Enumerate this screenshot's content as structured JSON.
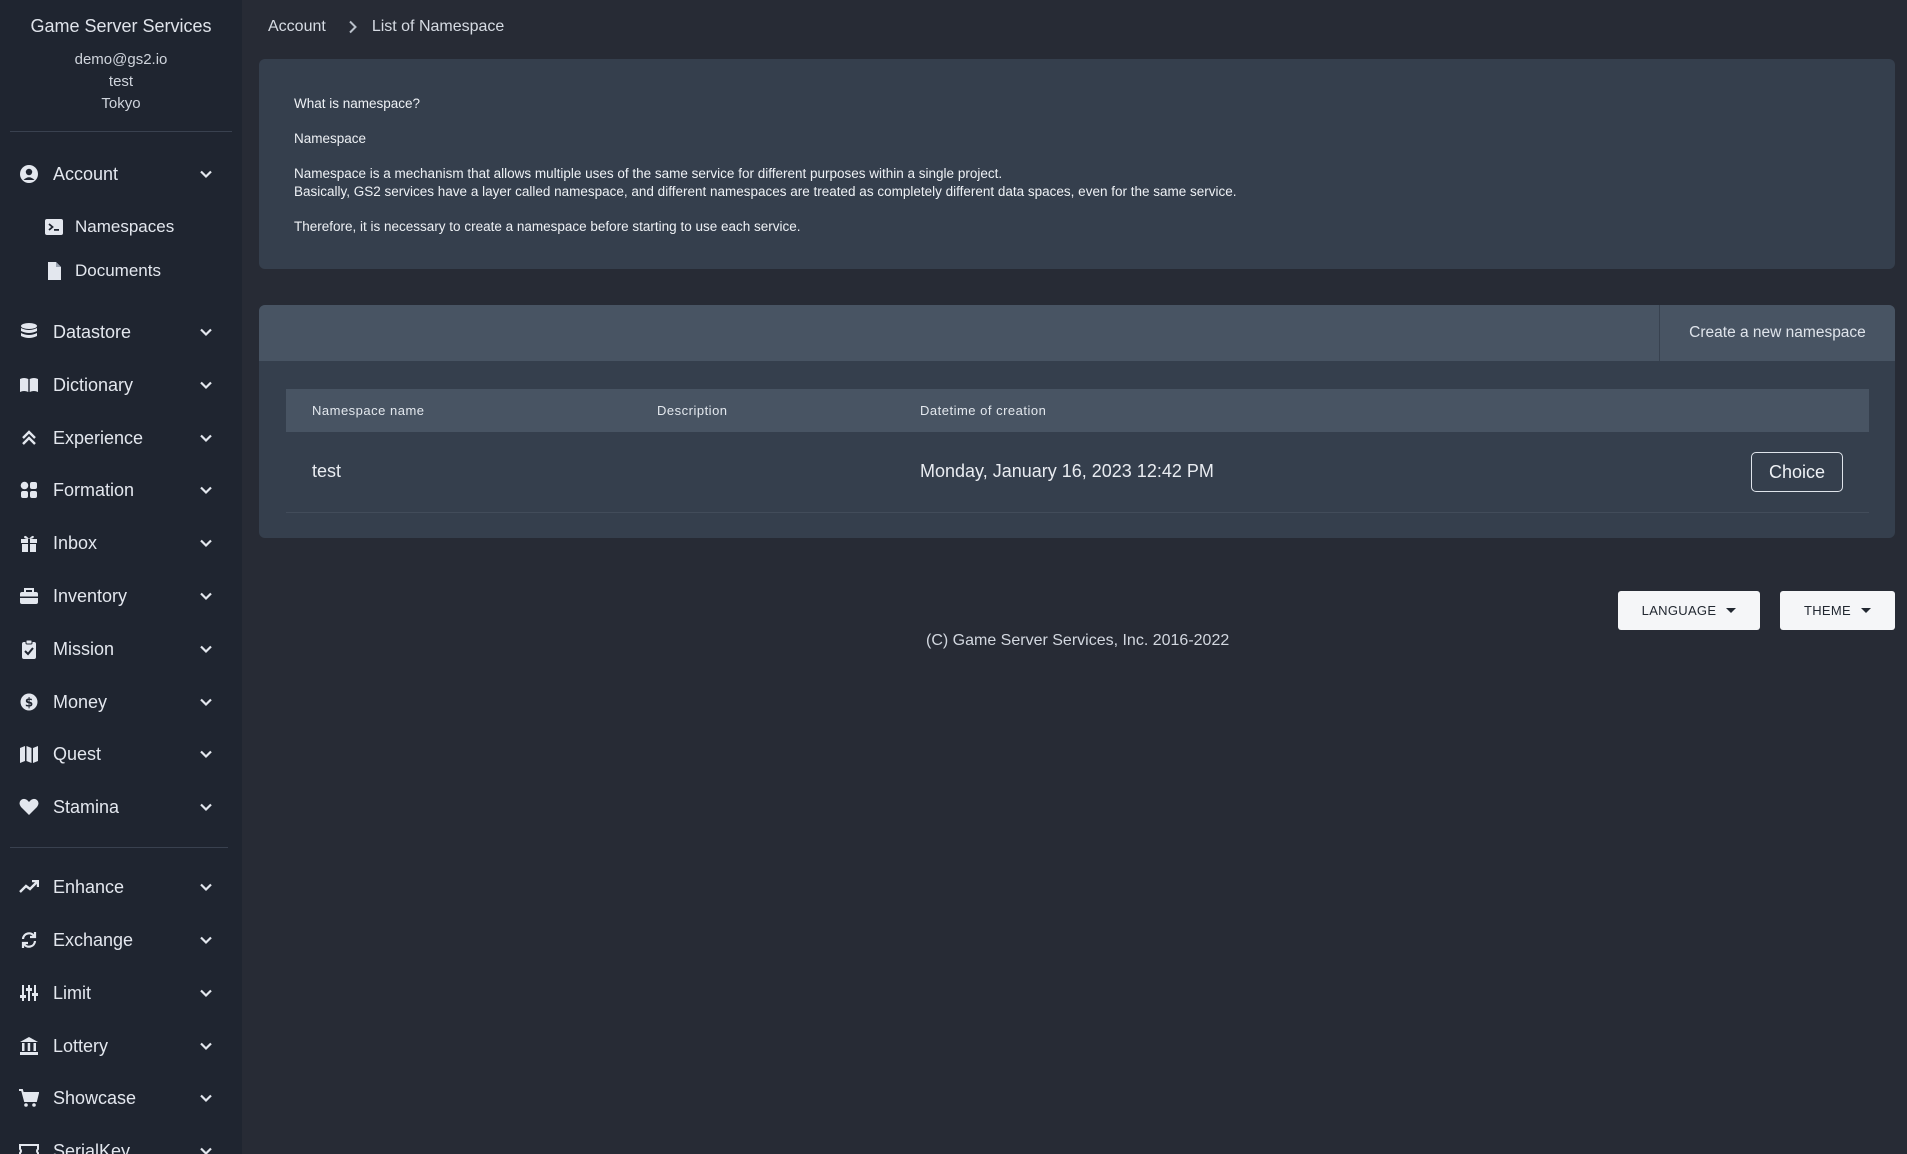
{
  "sidebar": {
    "title": "Game Server Services",
    "user_email": "demo@gs2.io",
    "project": "test",
    "region": "Tokyo",
    "sections": [
      {
        "label": "Account",
        "icon": "user-circle-icon"
      },
      {
        "label": "Datastore",
        "icon": "database-icon"
      },
      {
        "label": "Dictionary",
        "icon": "book-icon"
      },
      {
        "label": "Experience",
        "icon": "double-chevron-up-icon"
      },
      {
        "label": "Formation",
        "icon": "grid-icon"
      },
      {
        "label": "Inbox",
        "icon": "gift-icon"
      },
      {
        "label": "Inventory",
        "icon": "toolbox-icon"
      },
      {
        "label": "Mission",
        "icon": "clipboard-check-icon"
      },
      {
        "label": "Money",
        "icon": "dollar-circle-icon"
      },
      {
        "label": "Quest",
        "icon": "map-icon"
      },
      {
        "label": "Stamina",
        "icon": "heart-icon"
      },
      {
        "label": "Enhance",
        "icon": "trend-up-icon"
      },
      {
        "label": "Exchange",
        "icon": "exchange-icon"
      },
      {
        "label": "Limit",
        "icon": "sliders-icon"
      },
      {
        "label": "Lottery",
        "icon": "bank-icon"
      },
      {
        "label": "Showcase",
        "icon": "cart-icon"
      },
      {
        "label": "SerialKey",
        "icon": "ticket-icon"
      }
    ],
    "account_sub": [
      {
        "label": "Namespaces",
        "icon": "terminal-icon"
      },
      {
        "label": "Documents",
        "icon": "file-icon"
      }
    ]
  },
  "breadcrumb": {
    "parent": "Account",
    "current": "List of Namespace"
  },
  "info": {
    "question": "What is namespace?",
    "heading": "Namespace",
    "line1": "Namespace is a mechanism that allows multiple uses of the same service for different purposes within a single project.",
    "line2": "Basically, GS2 services have a layer called namespace, and different namespaces are treated as completely different data spaces, even for the same service.",
    "line3": "Therefore, it is necessary to create a namespace before starting to use each service."
  },
  "namespaces": {
    "create_label": "Create a new namespace",
    "columns": {
      "name": "Namespace name",
      "description": "Description",
      "created": "Datetime of creation"
    },
    "rows": [
      {
        "name": "test",
        "description": "",
        "created": "Monday, January 16, 2023 12:42 PM",
        "action": "Choice"
      }
    ]
  },
  "footer": {
    "language_label": "LANGUAGE",
    "theme_label": "THEME",
    "copyright": "(C) Game Server Services, Inc. 2016-2022"
  }
}
